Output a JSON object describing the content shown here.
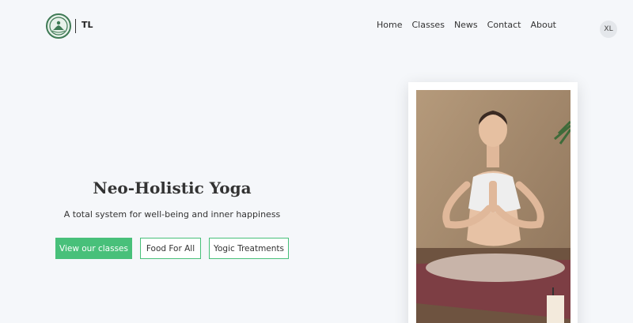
{
  "header": {
    "brand": "TL",
    "nav": [
      "Home",
      "Classes",
      "News",
      "Contact",
      "About"
    ],
    "avatar_initials": "XL",
    "logo_icon": "lotus-emblem-icon"
  },
  "hero": {
    "title": "Neo-Holistic Yoga",
    "subtitle": "A total system for well-being and inner happiness",
    "buttons": {
      "primary": "View our classes",
      "food": "Food For All",
      "yogic": "Yogic Treatments"
    },
    "image_alt": "Woman meditating in lotus pose"
  },
  "colors": {
    "accent": "#48c07a",
    "background": "#f5f7fa",
    "logo_green": "#3f7a55"
  }
}
